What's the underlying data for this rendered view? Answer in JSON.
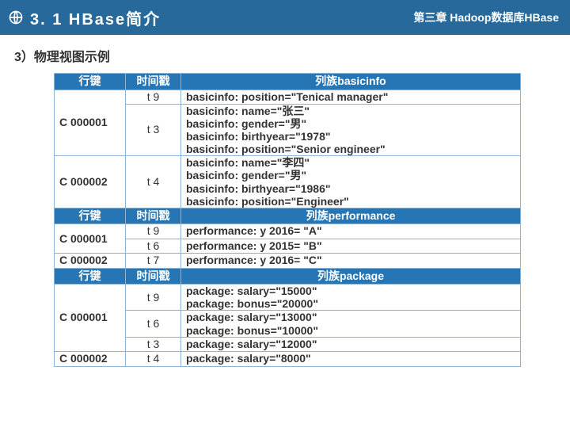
{
  "header": {
    "left_title": "3. 1  HBase简介",
    "right_title": "第三章  Hadoop数据库HBase",
    "globe_icon": "globe-icon"
  },
  "section": {
    "title": "3）物理视图示例"
  },
  "headers": {
    "rowkey": "行键",
    "timestamp": "时间戳",
    "cf_basicinfo": "列族basicinfo",
    "cf_performance": "列族performance",
    "cf_package": "列族package"
  },
  "basicinfo": {
    "r1": {
      "rowkey": "",
      "ts": "t 9",
      "val": "basicinfo: position=\"Tenical manager\""
    },
    "r2": {
      "rowkey": "C 000001",
      "ts": "t 3",
      "l1": "basicinfo: name=\"张三\"",
      "l2": "basicinfo: gender=\"男\"",
      "l3": "basicinfo: birthyear=\"1978\"",
      "l4": "basicinfo: position=\"Senior engineer\""
    },
    "r3": {
      "rowkey": "C 000002",
      "ts": "t 4",
      "l1": "basicinfo: name=\"李四\"",
      "l2": "basicinfo: gender=\"男\"",
      "l3": "basicinfo: birthyear=\"1986\"",
      "l4": "basicinfo: position=\"Engineer\""
    }
  },
  "performance": {
    "r1": {
      "rowkey": "C 000001",
      "ts": "t 9",
      "val": "performance: y 2016= \"A\""
    },
    "r2": {
      "rowkey": "",
      "ts": "t 6",
      "val": "performance: y 2015= \"B\""
    },
    "r3": {
      "rowkey": "C 000002",
      "ts": "t 7",
      "val": "performance: y 2016= \"C\""
    }
  },
  "package": {
    "r1": {
      "rowkey": "",
      "ts": "t 9",
      "l1": "package: salary=\"15000\"",
      "l2": "package: bonus=\"20000\""
    },
    "r2": {
      "rowkey": "C 000001",
      "ts": "t 6",
      "l1": "package: salary=\"13000\"",
      "l2": "package: bonus=\"10000\""
    },
    "r3": {
      "rowkey": "",
      "ts": "t 3",
      "val": "package: salary=\"12000\""
    },
    "r4": {
      "rowkey": "C 000002",
      "ts": "t 4",
      "val": "package: salary=\"8000\""
    }
  }
}
